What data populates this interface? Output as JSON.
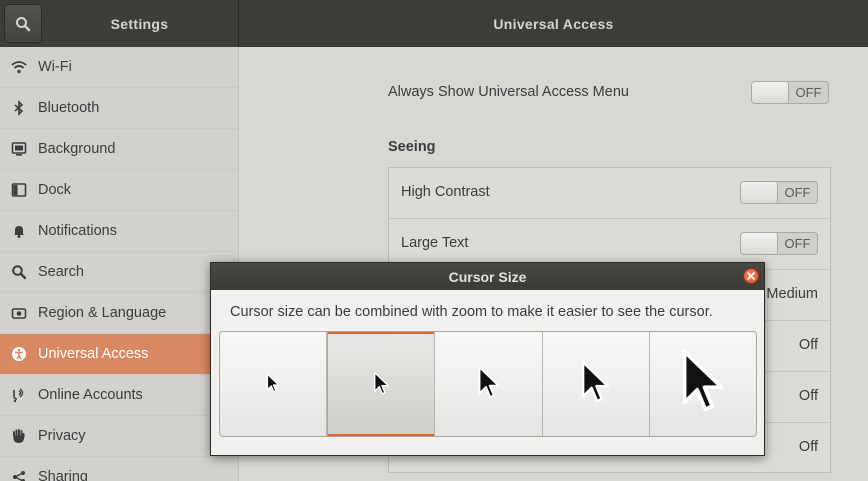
{
  "header": {
    "left_title": "Settings",
    "right_title": "Universal Access",
    "search_icon": "search-icon"
  },
  "sidebar": {
    "items": [
      {
        "label": "Wi-Fi",
        "icon": "wifi-icon"
      },
      {
        "label": "Bluetooth",
        "icon": "bluetooth-icon"
      },
      {
        "label": "Background",
        "icon": "background-icon"
      },
      {
        "label": "Dock",
        "icon": "dock-icon"
      },
      {
        "label": "Notifications",
        "icon": "bell-icon"
      },
      {
        "label": "Search",
        "icon": "search-icon"
      },
      {
        "label": "Region & Language",
        "icon": "camera-icon"
      },
      {
        "label": "Universal Access",
        "icon": "accessibility-icon",
        "selected": true
      },
      {
        "label": "Online Accounts",
        "icon": "online-accounts-icon"
      },
      {
        "label": "Privacy",
        "icon": "hand-icon"
      },
      {
        "label": "Sharing",
        "icon": "share-icon"
      }
    ]
  },
  "main": {
    "always_show_label": "Always Show Universal Access Menu",
    "always_show_state": "OFF",
    "seeing_title": "Seeing",
    "rows": [
      {
        "label": "High Contrast",
        "state": "OFF"
      },
      {
        "label": "Large Text",
        "state": "OFF"
      },
      {
        "label": "",
        "value": "Medium"
      },
      {
        "label": "",
        "value": "Off"
      },
      {
        "label": "",
        "value": "Off"
      },
      {
        "label": "",
        "value": "Off"
      }
    ]
  },
  "dialog": {
    "title": "Cursor Size",
    "description": "Cursor size can be combined with zoom to make it easier to see the cursor.",
    "close_icon": "close-icon",
    "selected_index": 1,
    "options": [
      "cursor-size-1",
      "cursor-size-2",
      "cursor-size-3",
      "cursor-size-4",
      "cursor-size-5"
    ]
  },
  "colors": {
    "accent": "#e0652f",
    "selected_sidebar": "#d88863",
    "headerbar": "#3d3c37"
  }
}
